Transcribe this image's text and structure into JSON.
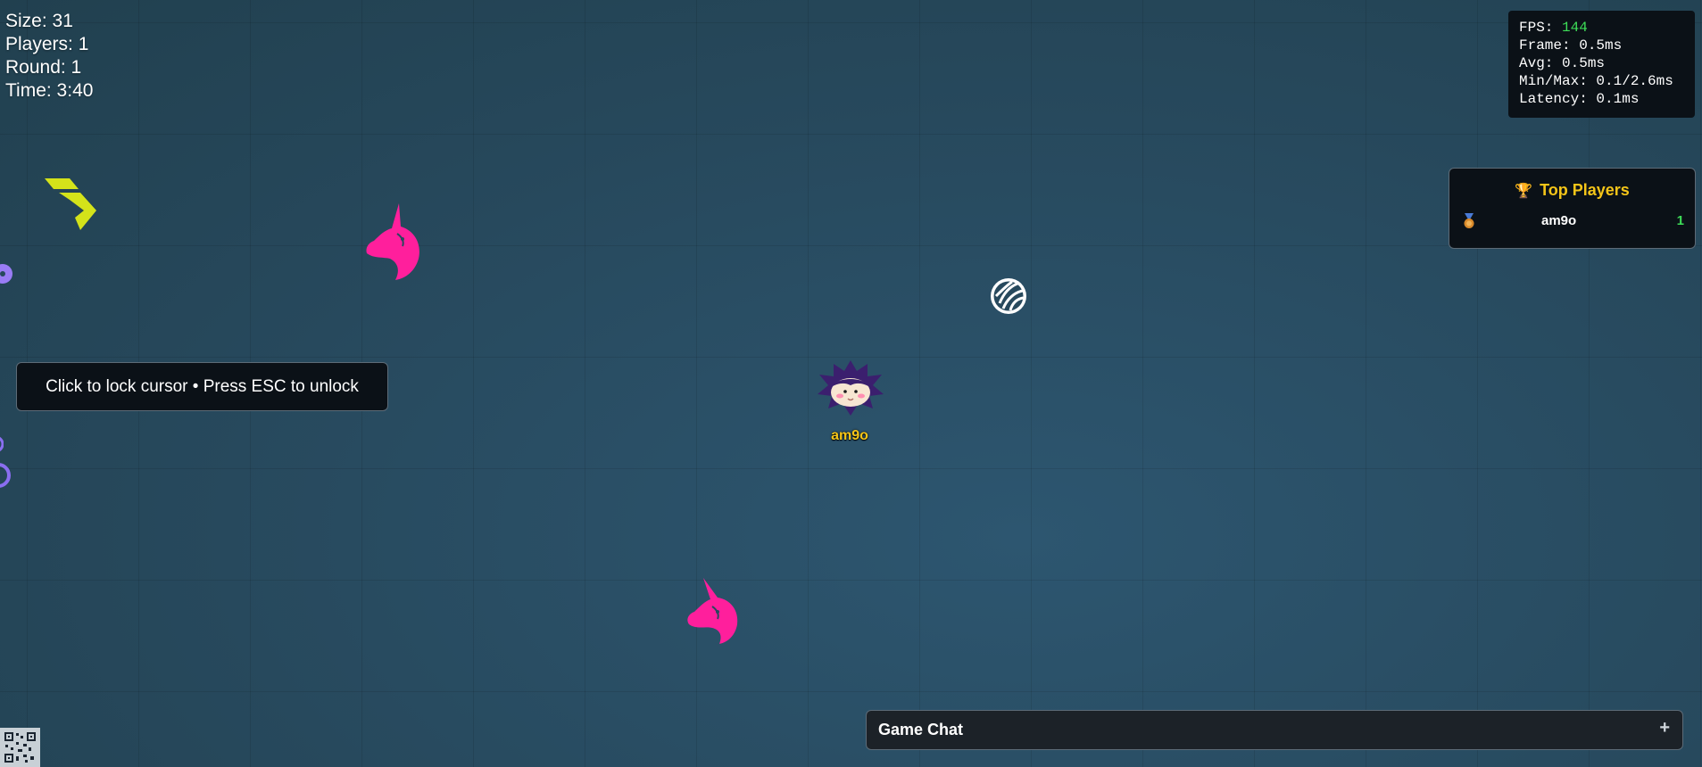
{
  "hud": {
    "size": "Size: 31",
    "players": "Players: 1",
    "round": "Round: 1",
    "time": "Time: 3:40"
  },
  "performance": {
    "fps_label": "FPS: ",
    "fps_value": "144",
    "frame": "Frame: 0.5ms",
    "avg": "Avg: 0.5ms",
    "minmax": "Min/Max: 0.1/2.6ms",
    "latency": "Latency: 0.1ms"
  },
  "leaderboard": {
    "title": "Top Players",
    "trophy_icon": "trophy-icon",
    "entries": [
      {
        "medal_icon": "bronze-medal-icon",
        "name": "am9o",
        "score": "1"
      }
    ]
  },
  "lock_hint": "Click to lock cursor • Press ESC to unlock",
  "player": {
    "name": "am9o",
    "avatar_icon": "spiky-hair-avatar-icon"
  },
  "chat": {
    "title": "Game Chat",
    "toggle": "+"
  },
  "pickups": [
    {
      "icon": "yellow-token-icon",
      "color": "#d4e31a"
    },
    {
      "icon": "unicorn-icon",
      "color": "#ff1f9c"
    },
    {
      "icon": "unicorn-icon",
      "color": "#ff1f9c"
    },
    {
      "icon": "striped-ball-icon",
      "color": "#ffffff"
    },
    {
      "icon": "purple-ring-icon",
      "color": "#8a6ef0"
    }
  ],
  "colors": {
    "background": "#27495d",
    "panel": "#0b1117",
    "accent_gold": "#f5c518",
    "accent_green": "#3ddc57"
  }
}
